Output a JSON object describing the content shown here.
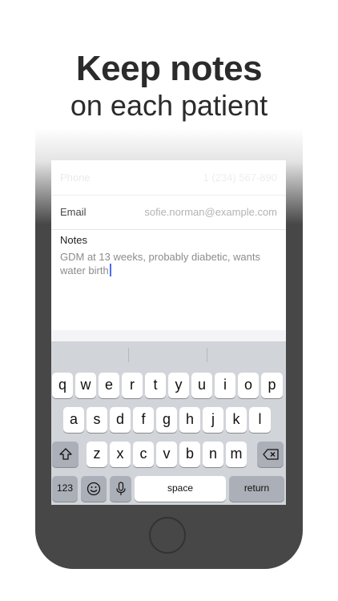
{
  "headline": {
    "line1": "Keep notes",
    "line2": "on each patient"
  },
  "form": {
    "phone": {
      "label": "Phone",
      "value": "1 (234) 567-890"
    },
    "email": {
      "label": "Email",
      "value": "sofie.norman@example.com"
    },
    "notes": {
      "label": "Notes",
      "value": "GDM at 13 weeks, probably diabetic, wants water birth"
    }
  },
  "keyboard": {
    "row1": [
      "q",
      "w",
      "e",
      "r",
      "t",
      "y",
      "u",
      "i",
      "o",
      "p"
    ],
    "row2": [
      "a",
      "s",
      "d",
      "f",
      "g",
      "h",
      "j",
      "k",
      "l"
    ],
    "row3": [
      "z",
      "x",
      "c",
      "v",
      "b",
      "n",
      "m"
    ],
    "numbers_key": "123",
    "space_key": "space",
    "return_key": "return",
    "icons": [
      "shift-icon",
      "backspace-icon",
      "emoji-icon",
      "microphone-icon"
    ]
  },
  "colors": {
    "cursor": "#4a6cf7",
    "phone_body": "#474747",
    "keyboard_bg": "#d1d4d9"
  }
}
